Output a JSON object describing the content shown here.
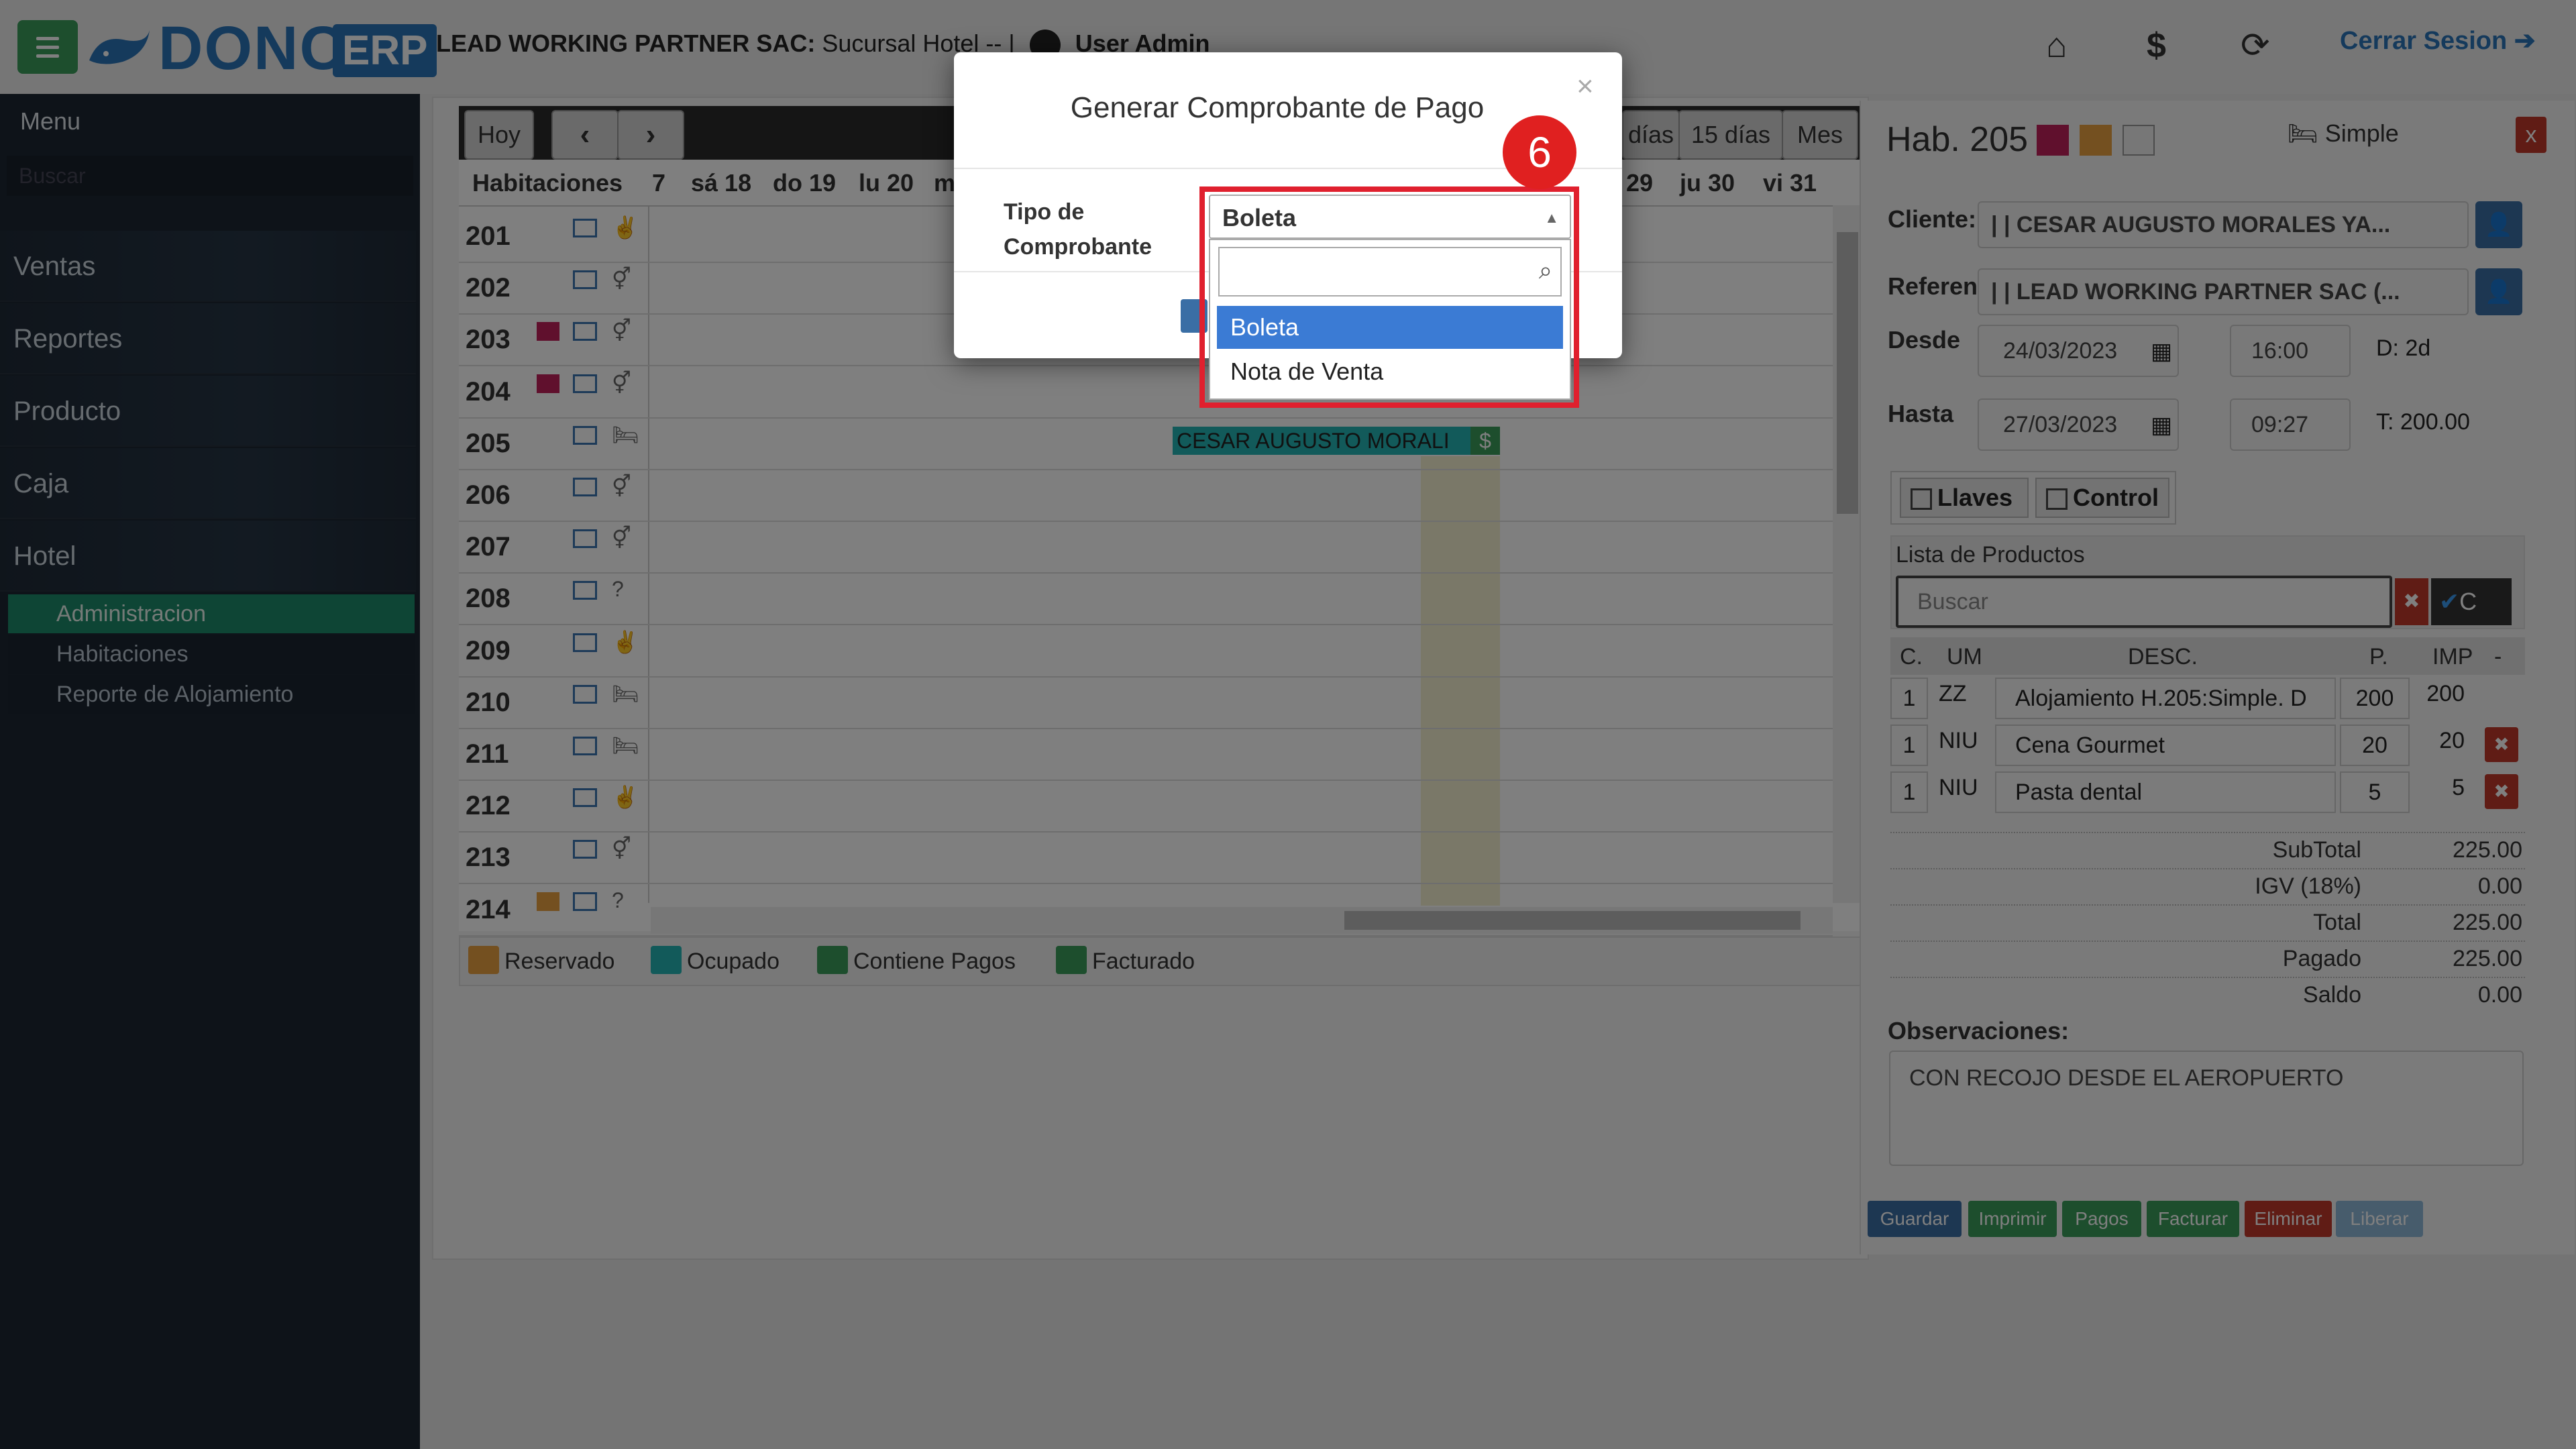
{
  "header": {
    "logo_text": "DONCA",
    "logo_badge": "ERP",
    "company_bold": "LEAD WORKING PARTNER SAC:",
    "company_rest": "Sucursal Hotel -- |",
    "user": "User Admin",
    "logout": "Cerrar Sesion"
  },
  "sidebar": {
    "title": "Menu",
    "search_placeholder": "Buscar",
    "items": [
      "Ventas",
      "Reportes",
      "Producto",
      "Caja",
      "Hotel"
    ],
    "sub_items": [
      "Administracion",
      "Habitaciones",
      "Reporte de Alojamiento"
    ]
  },
  "calendar": {
    "buttons": {
      "today": "Hoy",
      "prev": "‹",
      "next": "›",
      "days": "días",
      "fifteen": "15 días",
      "month": "Mes"
    },
    "rooms_header": "Habitaciones",
    "days": [
      "7",
      "sá 18",
      "do 19",
      "lu 20",
      "m",
      "29",
      "ju 30",
      "vi 31"
    ],
    "rooms": [
      "201",
      "202",
      "203",
      "204",
      "205",
      "206",
      "207",
      "208",
      "209",
      "210",
      "211",
      "212",
      "213",
      "214"
    ],
    "booking": "CESAR AUGUSTO MORALI",
    "booking_icon": "$",
    "legend": [
      "Reservado",
      "Ocupado",
      "Contiene Pagos",
      "Facturado"
    ],
    "legend_colors": [
      "#e8a040",
      "#25b5b5",
      "#3a9c5a",
      "#3a9c5a"
    ]
  },
  "right_panel": {
    "room_title": "Hab. 205",
    "room_type": "Simple",
    "close": "x",
    "cliente_label": "Cliente:",
    "cliente_value": "| | CESAR AUGUSTO MORALES YA...",
    "referencia_label": "Referen",
    "referencia_value": "| | LEAD WORKING PARTNER SAC (...",
    "desde_label": "Desde",
    "desde_date": "24/03/2023",
    "desde_time": "16:00",
    "desde_extra": "D: 2d",
    "hasta_label": "Hasta",
    "hasta_date": "27/03/2023",
    "hasta_time": "09:27",
    "hasta_extra": "T: 200.00",
    "llaves": "Llaves",
    "control": "Control",
    "productos_title": "Lista de Productos",
    "productos_search": "Buscar",
    "productos_check": "C",
    "columns": [
      "C.",
      "UM",
      "DESC.",
      "P.",
      "IMP",
      "-"
    ],
    "rows": [
      {
        "c": "1",
        "um": "ZZ",
        "desc": "Alojamiento H.205:Simple. D",
        "p": "200",
        "imp": "200"
      },
      {
        "c": "1",
        "um": "NIU",
        "desc": "Cena Gourmet",
        "p": "20",
        "imp": "20"
      },
      {
        "c": "1",
        "um": "NIU",
        "desc": "Pasta dental",
        "p": "5",
        "imp": "5"
      }
    ],
    "totals": [
      {
        "label": "SubTotal",
        "value": "225.00"
      },
      {
        "label": "IGV (18%)",
        "value": "0.00"
      },
      {
        "label": "Total",
        "value": "225.00"
      },
      {
        "label": "Pagado",
        "value": "225.00"
      },
      {
        "label": "Saldo",
        "value": "0.00"
      }
    ],
    "observaciones_label": "Observaciones:",
    "observaciones_value": "CON RECOJO DESDE EL AEROPUERTO",
    "actions": [
      "Guardar",
      "Imprimir",
      "Pagos",
      "Facturar",
      "Eliminar",
      "Liberar"
    ],
    "action_colors": [
      "#3a6ea5",
      "#3a9c5a",
      "#3a9c5a",
      "#3a9c5a",
      "#c0392b",
      "#8fb8d8"
    ]
  },
  "modal": {
    "title": "Generar Comprobante de Pago",
    "close": "×",
    "tipo_label_1": "Tipo de",
    "tipo_label_2": "Comprobante",
    "selected": "Boleta",
    "options": [
      "Boleta",
      "Nota de Venta"
    ],
    "step": "6"
  }
}
